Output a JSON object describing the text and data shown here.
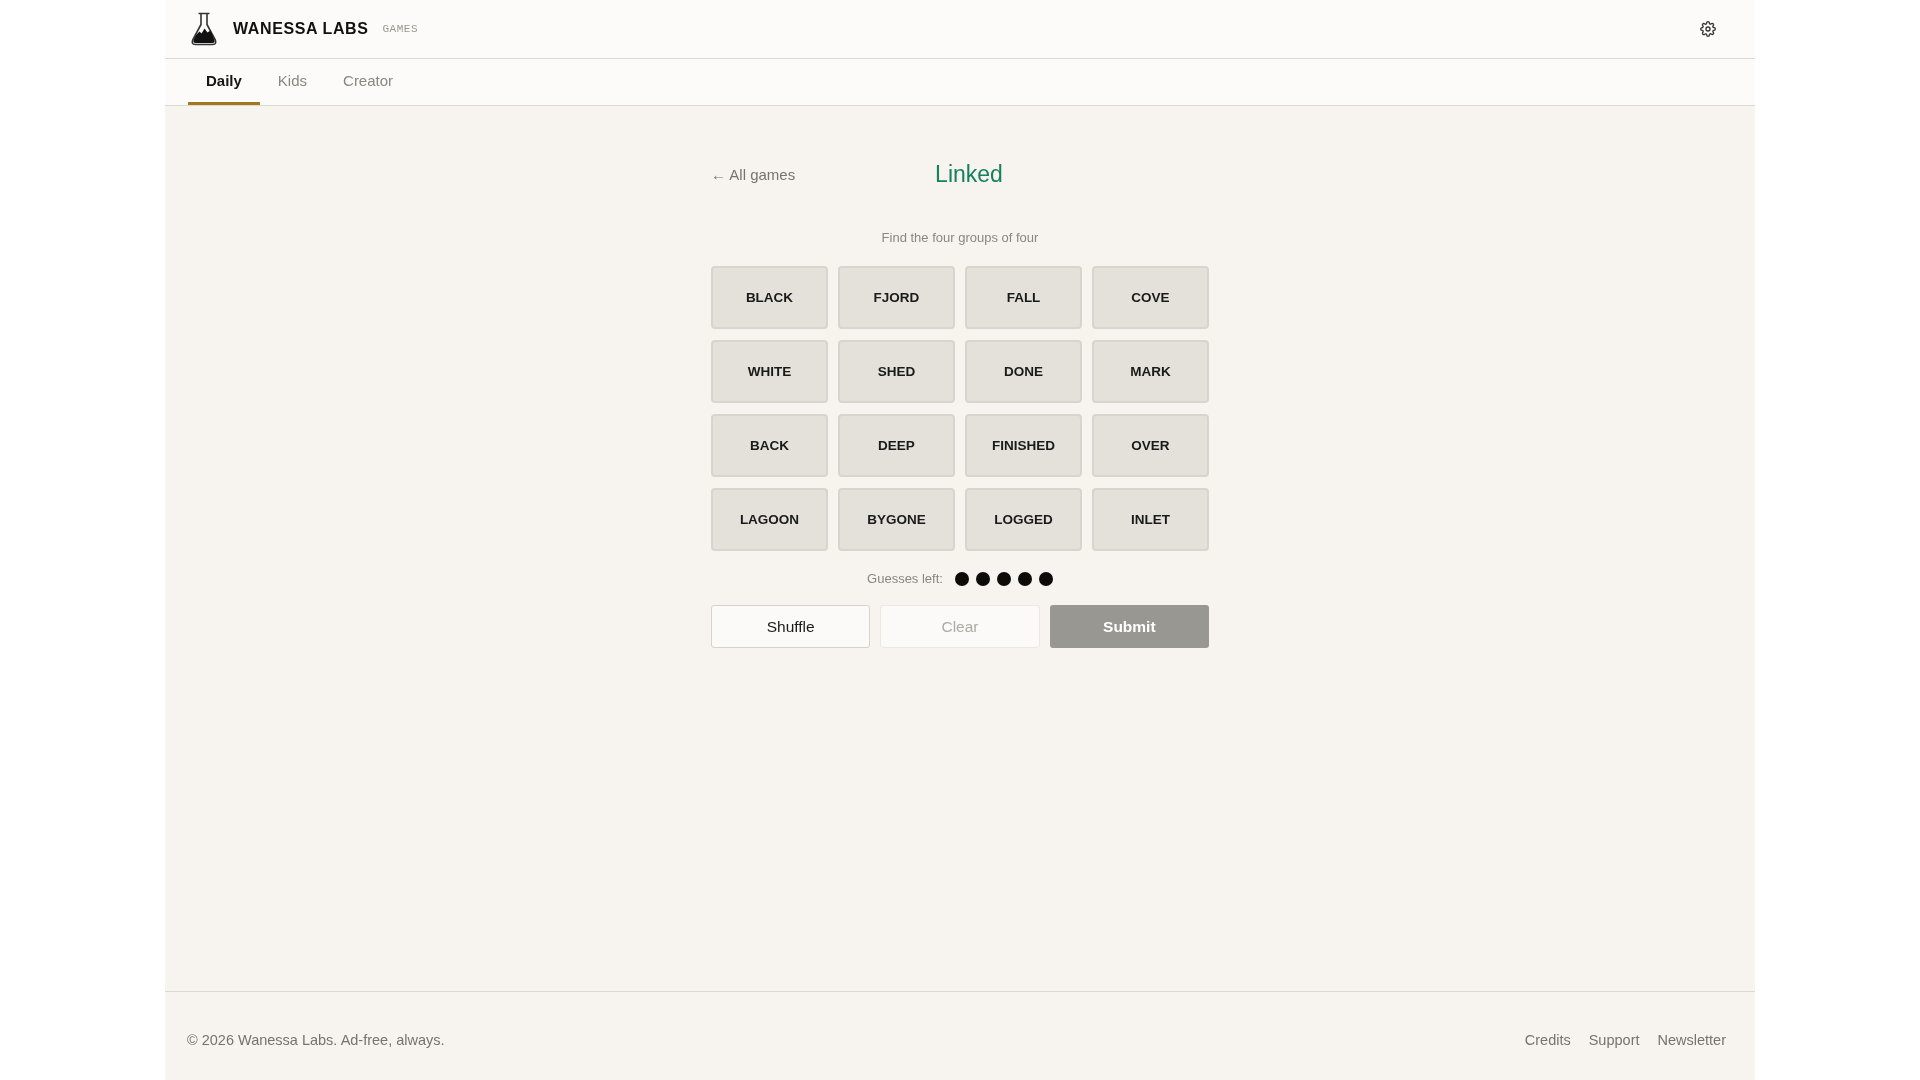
{
  "header": {
    "brand": "WANESSA LABS",
    "brand_tag": "GAMES"
  },
  "tabs": [
    {
      "label": "Daily",
      "selected": true
    },
    {
      "label": "Kids",
      "selected": false
    },
    {
      "label": "Creator",
      "selected": false
    }
  ],
  "game": {
    "back_link": "← All games",
    "title": "Linked",
    "instructions": "Find the four groups of four",
    "tiles": [
      {
        "word": "BLACK",
        "selected": false
      },
      {
        "word": "FJORD",
        "selected": false
      },
      {
        "word": "FALL",
        "selected": false
      },
      {
        "word": "COVE",
        "selected": false
      },
      {
        "word": "WHITE",
        "selected": false
      },
      {
        "word": "SHED",
        "selected": false
      },
      {
        "word": "DONE",
        "selected": false
      },
      {
        "word": "MARK",
        "selected": false
      },
      {
        "word": "BACK",
        "selected": false
      },
      {
        "word": "DEEP",
        "selected": false
      },
      {
        "word": "FINISHED",
        "selected": false
      },
      {
        "word": "OVER",
        "selected": false
      },
      {
        "word": "LAGOON",
        "selected": false
      },
      {
        "word": "BYGONE",
        "selected": false
      },
      {
        "word": "LOGGED",
        "selected": false
      },
      {
        "word": "INLET",
        "selected": false
      }
    ],
    "guesses_label": "Guesses left:",
    "guesses": [
      {
        "remaining": true
      },
      {
        "remaining": true
      },
      {
        "remaining": true
      },
      {
        "remaining": true
      },
      {
        "remaining": true
      }
    ],
    "buttons": [
      {
        "label": "Shuffle",
        "kind": "secondary",
        "disabled": false
      },
      {
        "label": "Clear",
        "kind": "secondary",
        "disabled": true
      },
      {
        "label": "Submit",
        "kind": "primary",
        "disabled": true
      }
    ]
  },
  "footer": {
    "copyright": "© 2026 Wanessa Labs. Ad-free, always.",
    "links": [
      "Credits",
      "Support",
      "Newsletter"
    ]
  }
}
